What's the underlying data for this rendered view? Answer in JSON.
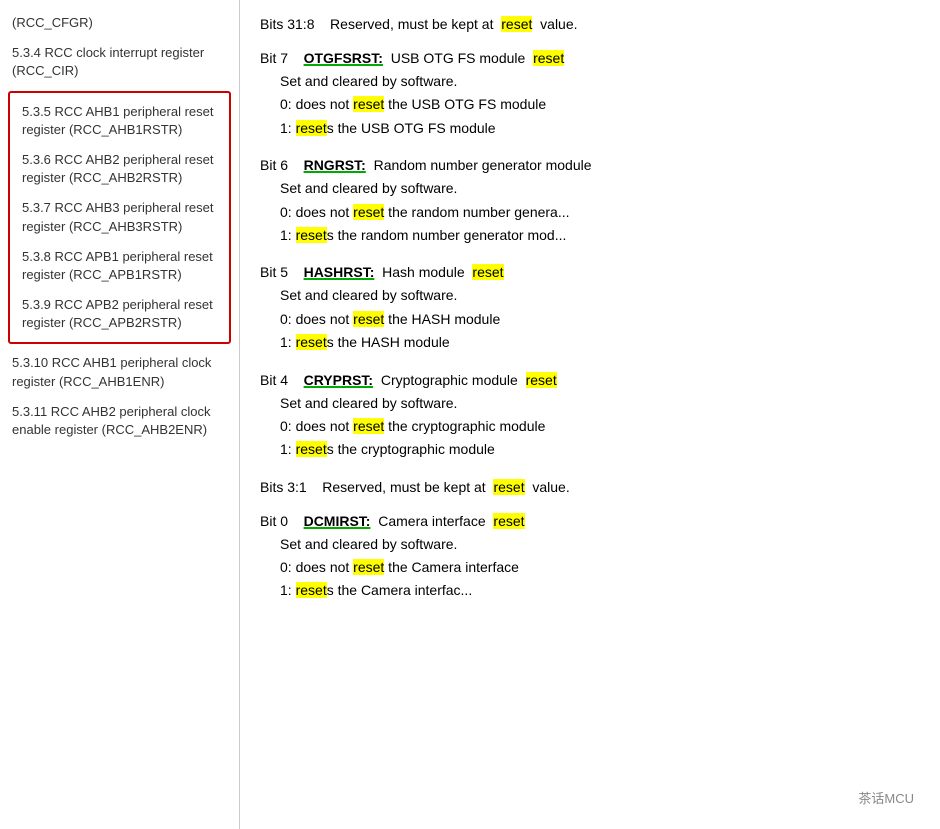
{
  "sidebar": {
    "items_top": [
      {
        "id": "rcc-cfgr",
        "text": "(RCC_CFGR)"
      },
      {
        "id": "rcc-cir",
        "text": "5.3.4 RCC clock interrupt register (RCC_CIR)"
      }
    ],
    "items_grouped": [
      {
        "id": "rcc-ahb1rstr",
        "text": "5.3.5 RCC AHB1 peripheral reset register (RCC_AHB1RSTR)"
      },
      {
        "id": "rcc-ahb2rstr",
        "text": "5.3.6 RCC AHB2 peripheral reset register (RCC_AHB2RSTR)"
      },
      {
        "id": "rcc-ahb3rstr",
        "text": "5.3.7 RCC AHB3 peripheral reset register (RCC_AHB3RSTR)"
      },
      {
        "id": "rcc-apb1rstr",
        "text": "5.3.8 RCC APB1 peripheral reset register (RCC_APB1RSTR)"
      },
      {
        "id": "rcc-apb2rstr",
        "text": "5.3.9 RCC APB2 peripheral reset register (RCC_APB2RSTR)"
      }
    ],
    "items_bottom": [
      {
        "id": "rcc-ahb1enr",
        "text": "5.3.10 RCC AHB1 peripheral clock register (RCC_AHB1ENR)"
      },
      {
        "id": "rcc-ahb2enr",
        "text": "5.3.11 RCC AHB2 peripheral clock enable register (RCC_AHB2ENR)"
      }
    ]
  },
  "main": {
    "bits_3108": {
      "label": "Bits 31:8",
      "text": "Reserved, must be kept at",
      "highlight": "reset",
      "text2": "value."
    },
    "bit7": {
      "label": "Bit 7",
      "name": "OTGFSRST:",
      "desc_before": "USB OTG FS module",
      "highlight": "reset",
      "lines": [
        "Set and cleared by software.",
        {
          "text": "0: does not",
          "highlight": "reset",
          "text2": "the USB OTG FS module"
        },
        {
          "text": "1:",
          "highlight": "resets",
          "text2": "the USB OTG FS module"
        }
      ]
    },
    "bit6": {
      "label": "Bit 6",
      "name": "RNGRST:",
      "desc_before": "Random number generator module",
      "lines": [
        "Set and cleared by software.",
        {
          "text": "0: does not",
          "highlight": "reset",
          "text2": "the random number genera..."
        },
        {
          "text": "1:",
          "highlight": "resets",
          "text2": "the random number generator mod..."
        }
      ]
    },
    "bit5": {
      "label": "Bit 5",
      "name": "HASHRST:",
      "desc_before": "Hash module",
      "highlight": "reset",
      "lines": [
        "Set and cleared by software.",
        {
          "text": "0: does not",
          "highlight": "reset",
          "text2": "the HASH module"
        },
        {
          "text": "1:",
          "highlight": "resets",
          "text2": "the HASH module"
        }
      ]
    },
    "bit4": {
      "label": "Bit 4",
      "name": "CRYPRST:",
      "desc_before": "Cryptographic module",
      "highlight": "reset",
      "lines": [
        "Set and cleared by software.",
        {
          "text": "0: does not",
          "highlight": "reset",
          "text2": "the cryptographic module"
        },
        {
          "text": "1:",
          "highlight": "resets",
          "text2": "the cryptographic module"
        }
      ]
    },
    "bits_31": {
      "label": "Bits 3:1",
      "text": "Reserved, must be kept at",
      "highlight": "reset",
      "text2": "value."
    },
    "bit0": {
      "label": "Bit 0",
      "name": "DCMIRST:",
      "desc_before": "Camera interface",
      "highlight": "reset",
      "lines": [
        "Set and cleared by software.",
        {
          "text": "0: does not",
          "highlight": "reset",
          "text2": "the Camera interface"
        },
        {
          "text": "1:",
          "highlight": "resets",
          "text2": "the Camera interfac..."
        }
      ]
    }
  },
  "watermark": "茶话MCU"
}
